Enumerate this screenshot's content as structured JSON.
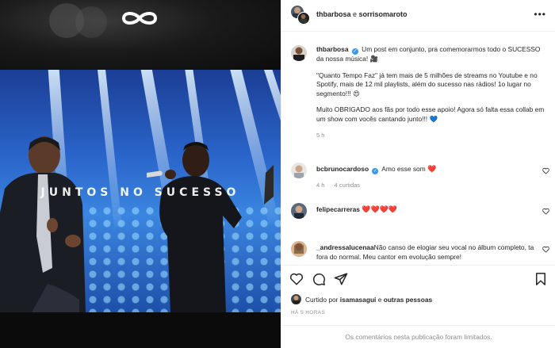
{
  "media": {
    "headline": "JUNTOS NO SUCESSO",
    "logo_icon": "infinity-logo-icon"
  },
  "header": {
    "user1": "thbarbosa",
    "connector": " e ",
    "user2": "sorrisomaroto",
    "more_icon": "more-options-icon"
  },
  "caption": {
    "username": "thbarbosa",
    "line1": "Um post em conjunto, pra comemorarmos todo o SUCESSO da nossa música!",
    "line1_emoji": "🎥",
    "line2": "\"Quanto Tempo Faz\" já tem mais de 5 milhões de streams no Youtube e no Spotify, mais de 12 mil playlists, além do sucesso nas rádios! 1o lugar no segmento!!!",
    "line2_emoji": "😍",
    "line3": "Muito OBRIGADO aos fãs por todo esse apoio! Agora só falta essa collab em um show com vocês cantando junto!!!",
    "line3_emoji": "💙",
    "time": "5 h"
  },
  "comments": [
    {
      "username": "bcbrunocardoso",
      "text": "Amo esse som",
      "emoji": "❤️",
      "time": "4 h",
      "likes": "4 curtidas"
    },
    {
      "username": "felipecarreras",
      "text": "",
      "emoji": "❤️❤️❤️❤️"
    },
    {
      "username": "_andressalucenaa",
      "text": "Não canso de elogiar seu vocal no álbum completo, ta fora do normal. Meu cantor em evolução sempre!"
    }
  ],
  "actions": {
    "icons": [
      "heart-icon",
      "comment-icon",
      "share-icon",
      "bookmark-icon"
    ]
  },
  "likes": {
    "prefix": "Curtido por ",
    "user": "isamasagui",
    "suffix": " e ",
    "others": "outras pessoas"
  },
  "date": "HÁ 5 HORAS",
  "limited_note": "Os comentários nesta publicação foram limitados."
}
